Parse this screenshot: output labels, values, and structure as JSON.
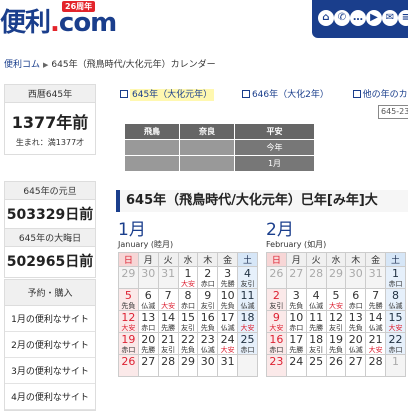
{
  "header": {
    "logo_text": "便利",
    "logo_dot": ".",
    "logo_suffix": "com",
    "logo_badge": "26周年",
    "icons": [
      "home-icon",
      "phone-icon",
      "chat-icon",
      "video-icon",
      "mail-icon",
      "doc-icon"
    ]
  },
  "breadcrumb": {
    "home": "便利コム",
    "current": "645年（飛鳥時代/大化元年）カレンダー"
  },
  "sidebar": {
    "year_head": "西暦645年",
    "years_ago": "1377年前",
    "born_text": "生まれ：満1377才",
    "gantan_head": "645年の元旦",
    "gantan_days": "503329日前",
    "omisoka_head": "645年の大晦日",
    "omisoka_days": "502965日前",
    "menu_head": "予約・購入",
    "menu_items": [
      "1月の便利なサイト",
      "2月の便利なサイト",
      "3月の便利なサイト",
      "4月の便利なサイト"
    ]
  },
  "nav": {
    "current": "645年（大化元年）",
    "next": "646年（大化2年）",
    "other": "他の年のカレン",
    "search_placeholder": "645-23"
  },
  "era_table": {
    "row1": [
      "飛鳥",
      "奈良",
      "平安"
    ],
    "row2": [
      "",
      "",
      "今年"
    ],
    "row3": [
      "",
      "",
      "1月"
    ]
  },
  "title": "645年（飛鳥時代/大化元年）巳年[み年]大",
  "calendars": [
    {
      "month": "1月",
      "sub": "January (睦月)",
      "weekdays": [
        "日",
        "月",
        "火",
        "水",
        "木",
        "金",
        "土"
      ],
      "weeks": [
        [
          {
            "n": "29",
            "r": "",
            "out": true
          },
          {
            "n": "30",
            "r": "",
            "out": true
          },
          {
            "n": "31",
            "r": "",
            "out": true
          },
          {
            "n": "1",
            "r": "大安"
          },
          {
            "n": "2",
            "r": "赤口"
          },
          {
            "n": "3",
            "r": "先勝"
          },
          {
            "n": "4",
            "r": "友引"
          }
        ],
        [
          {
            "n": "5",
            "r": "先負"
          },
          {
            "n": "6",
            "r": "仏滅"
          },
          {
            "n": "7",
            "r": "大安"
          },
          {
            "n": "8",
            "r": "赤口"
          },
          {
            "n": "9",
            "r": "友引"
          },
          {
            "n": "10",
            "r": "先負"
          },
          {
            "n": "11",
            "r": "仏滅"
          }
        ],
        [
          {
            "n": "12",
            "r": "大安"
          },
          {
            "n": "13",
            "r": "赤口"
          },
          {
            "n": "14",
            "r": "先勝"
          },
          {
            "n": "15",
            "r": "友引"
          },
          {
            "n": "16",
            "r": "先負"
          },
          {
            "n": "17",
            "r": "仏滅"
          },
          {
            "n": "18",
            "r": "大安"
          }
        ],
        [
          {
            "n": "19",
            "r": "赤口"
          },
          {
            "n": "20",
            "r": "先勝"
          },
          {
            "n": "21",
            "r": "友引"
          },
          {
            "n": "22",
            "r": "先負"
          },
          {
            "n": "23",
            "r": "仏滅"
          },
          {
            "n": "24",
            "r": "大安"
          },
          {
            "n": "25",
            "r": "赤口"
          }
        ],
        [
          {
            "n": "26",
            "r": ""
          },
          {
            "n": "27",
            "r": ""
          },
          {
            "n": "28",
            "r": ""
          },
          {
            "n": "29",
            "r": ""
          },
          {
            "n": "30",
            "r": ""
          },
          {
            "n": "31",
            "r": ""
          },
          {
            "n": "",
            "r": "",
            "out": true
          }
        ]
      ]
    },
    {
      "month": "2月",
      "sub": "February (如月)",
      "weekdays": [
        "日",
        "月",
        "火",
        "水",
        "木",
        "金",
        "土"
      ],
      "weeks": [
        [
          {
            "n": "26",
            "r": "",
            "out": true
          },
          {
            "n": "27",
            "r": "",
            "out": true
          },
          {
            "n": "28",
            "r": "",
            "out": true
          },
          {
            "n": "29",
            "r": "",
            "out": true
          },
          {
            "n": "30",
            "r": "",
            "out": true
          },
          {
            "n": "31",
            "r": "",
            "out": true
          },
          {
            "n": "1",
            "r": "赤口"
          }
        ],
        [
          {
            "n": "2",
            "r": "友引"
          },
          {
            "n": "3",
            "r": "先負"
          },
          {
            "n": "4",
            "r": "仏滅"
          },
          {
            "n": "5",
            "r": "大安"
          },
          {
            "n": "6",
            "r": "赤口"
          },
          {
            "n": "7",
            "r": "先勝"
          },
          {
            "n": "8",
            "r": "仏滅"
          }
        ],
        [
          {
            "n": "9",
            "r": "大安"
          },
          {
            "n": "10",
            "r": "赤口"
          },
          {
            "n": "11",
            "r": "先勝"
          },
          {
            "n": "12",
            "r": "友引"
          },
          {
            "n": "13",
            "r": "先負"
          },
          {
            "n": "14",
            "r": "仏滅"
          },
          {
            "n": "15",
            "r": "大安"
          }
        ],
        [
          {
            "n": "16",
            "r": "赤口"
          },
          {
            "n": "17",
            "r": "先勝"
          },
          {
            "n": "18",
            "r": "友引"
          },
          {
            "n": "19",
            "r": "先負"
          },
          {
            "n": "20",
            "r": "仏滅"
          },
          {
            "n": "21",
            "r": "大安"
          },
          {
            "n": "22",
            "r": "赤口"
          }
        ],
        [
          {
            "n": "23",
            "r": ""
          },
          {
            "n": "24",
            "r": ""
          },
          {
            "n": "25",
            "r": ""
          },
          {
            "n": "26",
            "r": ""
          },
          {
            "n": "27",
            "r": ""
          },
          {
            "n": "28",
            "r": ""
          },
          {
            "n": "1",
            "r": "",
            "out": true
          }
        ]
      ]
    }
  ]
}
